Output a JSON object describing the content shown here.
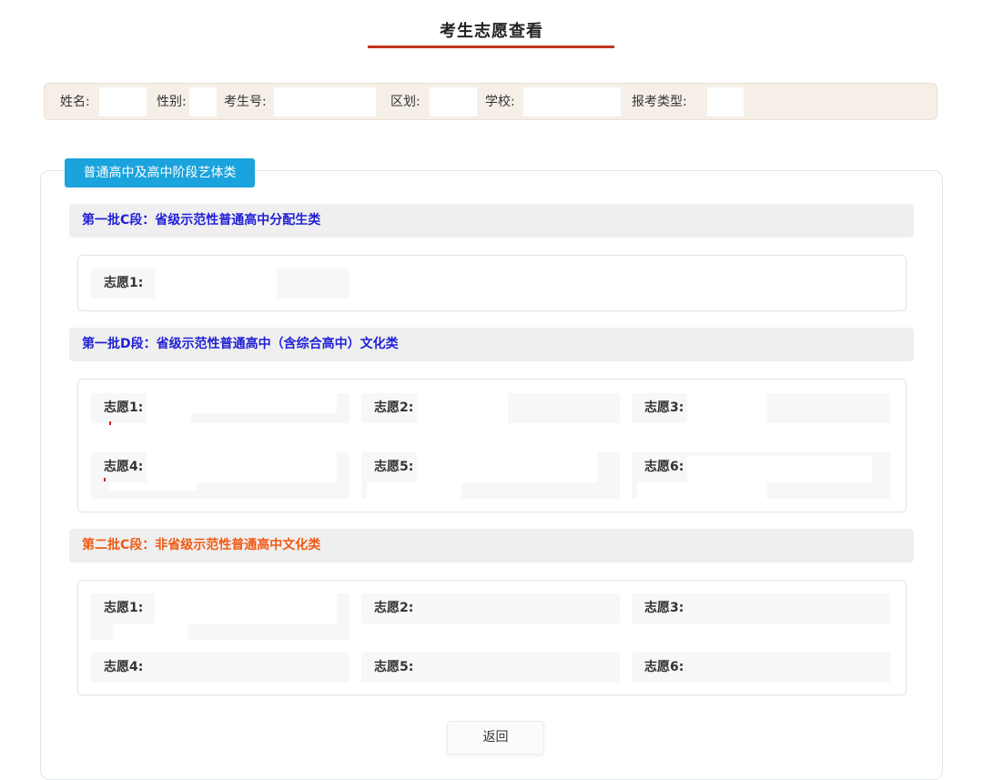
{
  "page": {
    "title": "考生志愿查看"
  },
  "info_bar": {
    "name_label": "姓名:",
    "gender_label": "性别:",
    "exam_no_label": "考生号:",
    "district_label": "区划:",
    "school_label": "学校:",
    "apply_type_label": "报考类型:"
  },
  "category_tab": "普通高中及高中阶段艺体类",
  "sections": [
    {
      "title": "第一批C段：省级示范性普通高中分配生类",
      "choices": [
        "志愿1:"
      ]
    },
    {
      "title": "第一批D段：省级示范性普通高中（含综合高中）文化类",
      "choices": [
        "志愿1:",
        "志愿2:",
        "志愿3:",
        "志愿4:",
        "志愿5:",
        "志愿6:"
      ]
    },
    {
      "title": "第二批C段：非省级示范性普通高中文化类",
      "choices": [
        "志愿1:",
        "志愿2:",
        "志愿3:",
        "志愿4:",
        "志愿5:",
        "志愿6:"
      ]
    }
  ],
  "actions": {
    "return_label": "返回"
  },
  "colors": {
    "title_accent": "#c0341d",
    "tab_blue": "#1aa3dc",
    "section_blue": "#1f1fd6",
    "section_orange": "#f05a14"
  }
}
